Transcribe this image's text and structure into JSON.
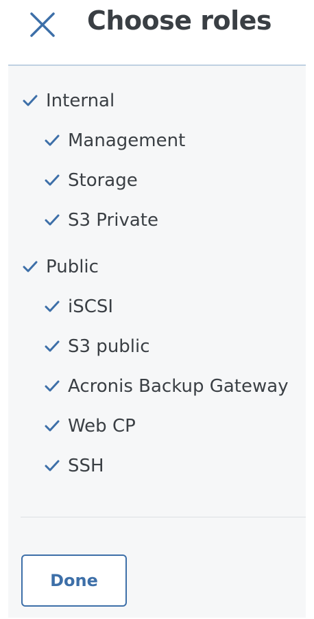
{
  "dialog": {
    "title": "Choose roles",
    "close_icon": "close-icon"
  },
  "colors": {
    "accent": "#3d6fa8",
    "text": "#3a3f44",
    "panel_bg": "#f6f7f8"
  },
  "groups": [
    {
      "label": "Internal",
      "checked": true,
      "roles": [
        {
          "label": "Management",
          "checked": true
        },
        {
          "label": "Storage",
          "checked": true
        },
        {
          "label": "S3 Private",
          "checked": true
        }
      ]
    },
    {
      "label": "Public",
      "checked": true,
      "roles": [
        {
          "label": "iSCSI",
          "checked": true
        },
        {
          "label": "S3 public",
          "checked": true
        },
        {
          "label": "Acronis Backup Gateway",
          "checked": true
        },
        {
          "label": "Web CP",
          "checked": true
        },
        {
          "label": "SSH",
          "checked": true
        }
      ]
    }
  ],
  "footer": {
    "done_label": "Done"
  }
}
